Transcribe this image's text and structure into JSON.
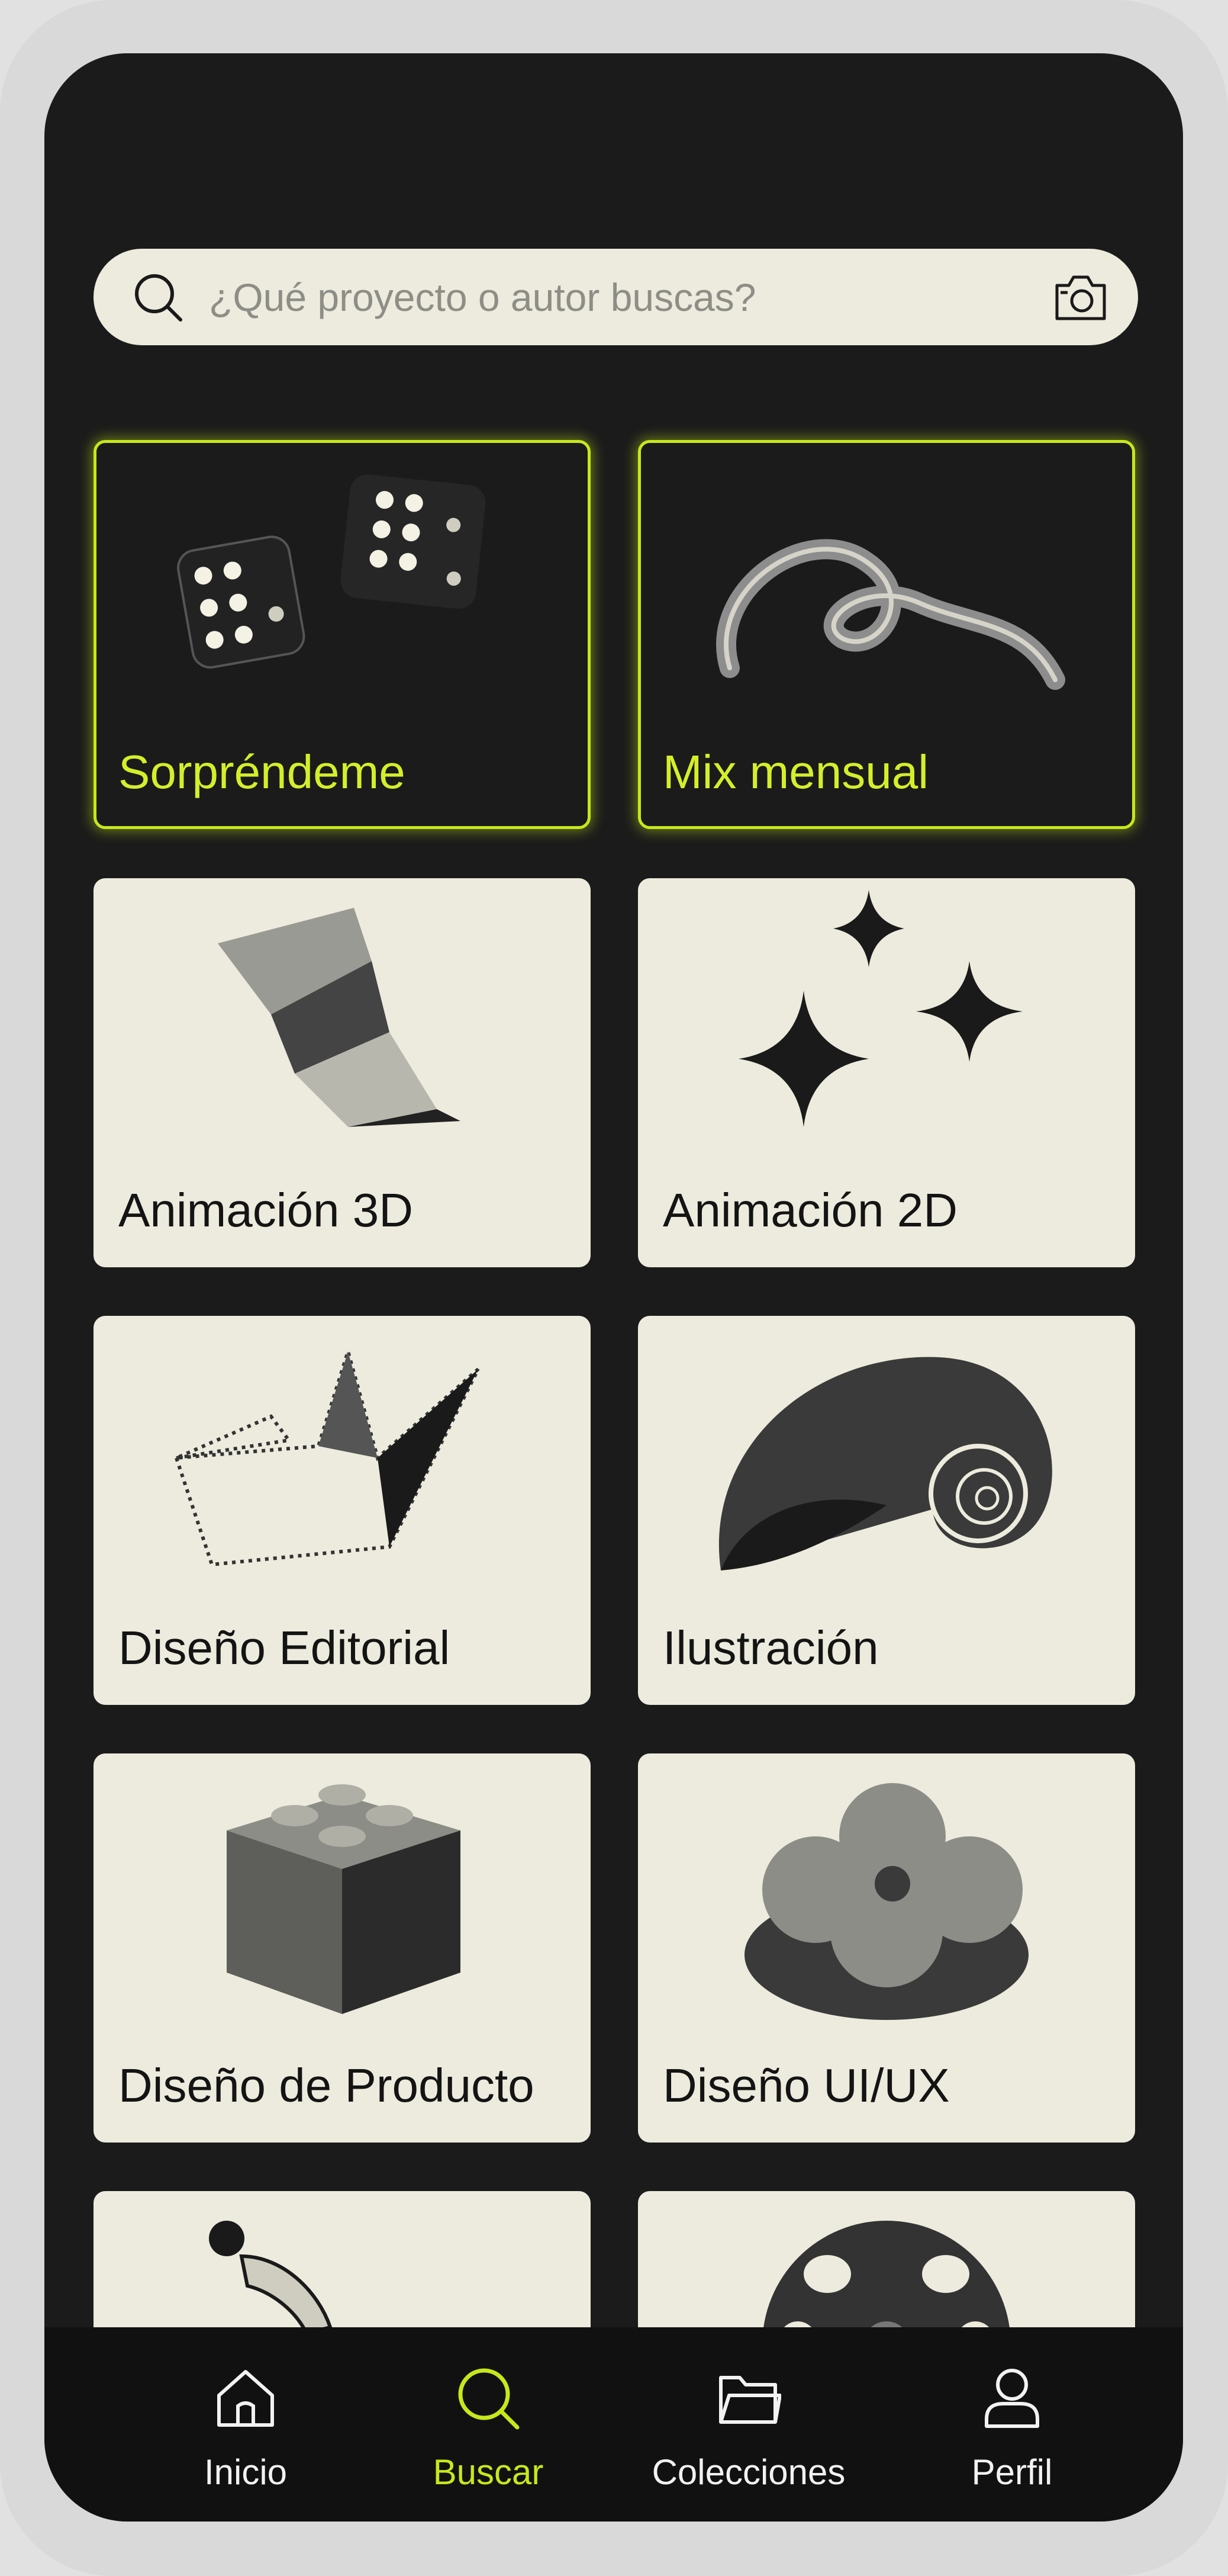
{
  "search": {
    "placeholder": "¿Qué proyecto o autor buscas?",
    "icon": "search-icon",
    "camera_icon": "camera-icon"
  },
  "categories": [
    {
      "label": "Sorpréndeme",
      "style": "highlight",
      "icon": "dice-icon"
    },
    {
      "label": "Mix mensual",
      "style": "highlight",
      "icon": "swirl-icon"
    },
    {
      "label": "Animación 3D",
      "style": "light",
      "icon": "twisted-ribbon-icon"
    },
    {
      "label": "Animación 2D",
      "style": "light",
      "icon": "sparkles-icon"
    },
    {
      "label": "Diseño Editorial",
      "style": "light",
      "icon": "paper-boat-icon"
    },
    {
      "label": "Ilustración",
      "style": "light",
      "icon": "nautilus-shell-icon"
    },
    {
      "label": "Diseño de Producto",
      "style": "light",
      "icon": "lego-brick-icon"
    },
    {
      "label": "Diseño UI/UX",
      "style": "light",
      "icon": "flower-shape-icon"
    },
    {
      "label": "",
      "style": "light",
      "icon": "photography-person-icon"
    },
    {
      "label": "",
      "style": "light",
      "icon": "film-reel-icon"
    }
  ],
  "nav": {
    "items": [
      {
        "label": "Inicio",
        "icon": "home-icon",
        "active": false
      },
      {
        "label": "Buscar",
        "icon": "search-icon",
        "active": true
      },
      {
        "label": "Colecciones",
        "icon": "folder-icon",
        "active": false
      },
      {
        "label": "Perfil",
        "icon": "user-icon",
        "active": false
      }
    ]
  },
  "colors": {
    "background": "#1b1b1b",
    "card": "#ecebdd",
    "accent": "#c6e81b",
    "nav_background": "#111111"
  }
}
